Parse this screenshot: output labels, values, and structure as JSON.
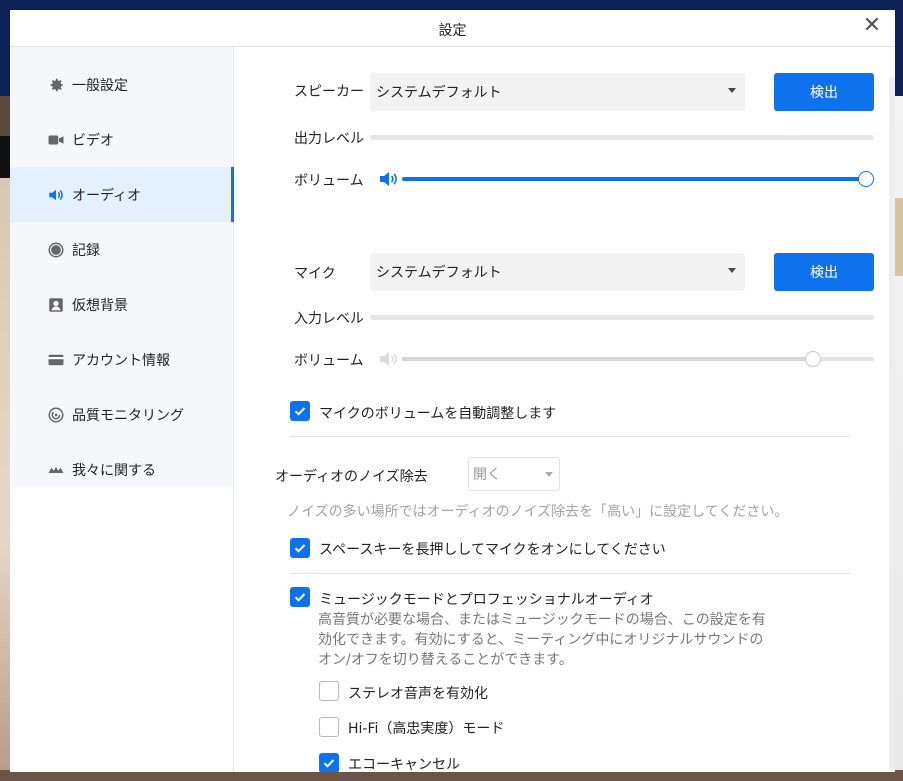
{
  "window": {
    "title": "設定",
    "close_icon": "close-icon"
  },
  "sidebar": {
    "items": [
      {
        "label": "一般設定",
        "icon": "gear-icon"
      },
      {
        "label": "ビデオ",
        "icon": "video-camera-icon"
      },
      {
        "label": "オーディオ",
        "icon": "speaker-icon",
        "active": true
      },
      {
        "label": "記録",
        "icon": "record-icon"
      },
      {
        "label": "仮想背景",
        "icon": "person-portrait-icon"
      },
      {
        "label": "アカウント情報",
        "icon": "card-icon"
      },
      {
        "label": "品質モニタリング",
        "icon": "gauge-icon"
      },
      {
        "label": "我々に関する",
        "icon": "logo-icon"
      }
    ]
  },
  "audio": {
    "speaker": {
      "label": "スピーカー",
      "selected": "システムデフォルト",
      "detect_label": "検出",
      "level_label": "出力レベル",
      "volume_label": "ボリューム",
      "volume": 1.0
    },
    "mic": {
      "label": "マイク",
      "selected": "システムデフォルト",
      "detect_label": "検出",
      "level_label": "入力レベル",
      "volume_label": "ボリューム",
      "volume": 0.87
    },
    "auto_adjust": {
      "label": "マイクのボリュームを自動調整します",
      "checked": true
    },
    "noise": {
      "label": "オーディオのノイズ除去",
      "selected": "開く",
      "hint": "ノイズの多い場所ではオーディオのノイズ除去を「高い」に設定してください。"
    },
    "space_key": {
      "label": "スペースキーを長押ししてマイクをオンにしてください",
      "checked": true
    },
    "music_mode": {
      "label": "ミュージックモードとプロフェッショナルオーディオ",
      "checked": true,
      "desc_line1": "高音質が必要な場合、またはミュージックモードの場合、この設定を有",
      "desc_line2": "効化できます。有効にすると、ミーティング中にオリジナルサウンドの",
      "desc_line3": "オン/オフを切り替えることができます。",
      "stereo": {
        "label": "ステレオ音声を有効化",
        "checked": false
      },
      "hifi": {
        "label": "Hi-Fi（高忠実度）モード",
        "checked": false
      },
      "echo": {
        "label": "エコーキャンセル",
        "checked": true
      }
    }
  },
  "colors": {
    "accent": "#0e72ed",
    "active_bg": "#e4efff",
    "muted": "#c8c8c8"
  }
}
